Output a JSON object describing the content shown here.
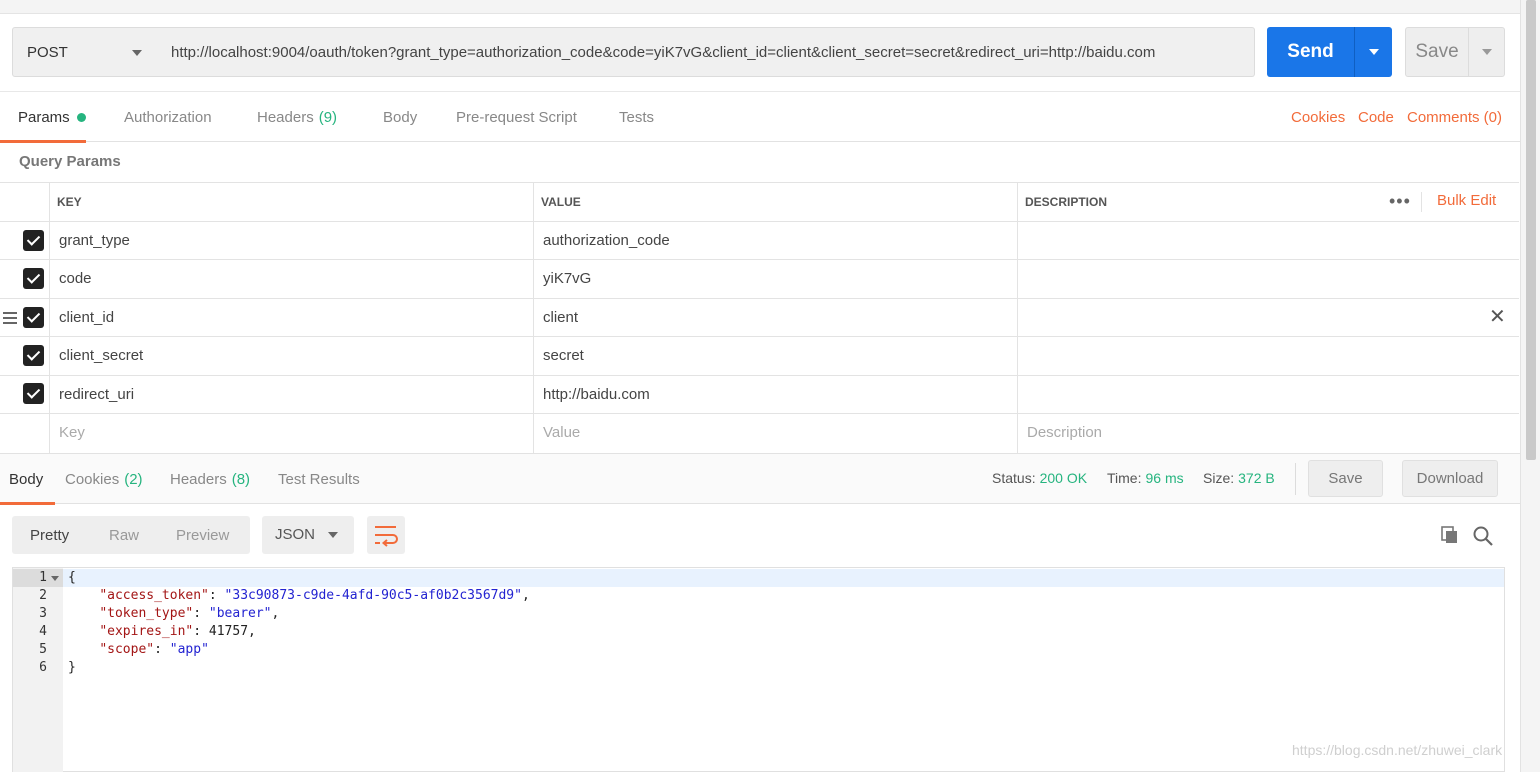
{
  "request": {
    "method": "POST",
    "url": "http://localhost:9004/oauth/token?grant_type=authorization_code&code=yiK7vG&client_id=client&client_secret=secret&redirect_uri=http://baidu.com",
    "send_label": "Send",
    "save_label": "Save"
  },
  "tabs": {
    "params": "Params",
    "authorization": "Authorization",
    "headers": "Headers",
    "headers_count": "(9)",
    "body": "Body",
    "prerequest": "Pre-request Script",
    "tests": "Tests"
  },
  "links": {
    "cookies": "Cookies",
    "code": "Code",
    "comments": "Comments (0)"
  },
  "query_params": {
    "title": "Query Params",
    "columns": {
      "key": "KEY",
      "value": "VALUE",
      "description": "DESCRIPTION"
    },
    "bulk_edit": "Bulk Edit",
    "more": "•••",
    "rows": [
      {
        "key": "grant_type",
        "value": "authorization_code",
        "checked": true
      },
      {
        "key": "code",
        "value": "yiK7vG",
        "checked": true
      },
      {
        "key": "client_id",
        "value": "client",
        "checked": true
      },
      {
        "key": "client_secret",
        "value": "secret",
        "checked": true
      },
      {
        "key": "redirect_uri",
        "value": "http://baidu.com",
        "checked": true
      }
    ],
    "placeholders": {
      "key": "Key",
      "value": "Value",
      "description": "Description"
    }
  },
  "response": {
    "tabs": {
      "body": "Body",
      "cookies": "Cookies",
      "cookies_count": "(2)",
      "headers": "Headers",
      "headers_count": "(8)",
      "test_results": "Test Results"
    },
    "status_label": "Status:",
    "status_value": "200 OK",
    "time_label": "Time:",
    "time_value": "96 ms",
    "size_label": "Size:",
    "size_value": "372 B",
    "save_label": "Save",
    "download_label": "Download",
    "formats": {
      "pretty": "Pretty",
      "raw": "Raw",
      "preview": "Preview"
    },
    "language": "JSON",
    "line_numbers": [
      "1",
      "2",
      "3",
      "4",
      "5",
      "6"
    ],
    "json": {
      "open_brace": "{",
      "close_brace": "}",
      "access_token_key": "\"access_token\"",
      "access_token_value": "\"33c90873-c9de-4afd-90c5-af0b2c3567d9\"",
      "token_type_key": "\"token_type\"",
      "token_type_value": "\"bearer\"",
      "expires_in_key": "\"expires_in\"",
      "expires_in_value": "41757",
      "scope_key": "\"scope\"",
      "scope_value": "\"app\""
    }
  },
  "watermark": "https://blog.csdn.net/zhuwei_clark",
  "colors": {
    "accent": "#f26b3a",
    "send": "#1a76e8",
    "success": "#26b47f"
  }
}
